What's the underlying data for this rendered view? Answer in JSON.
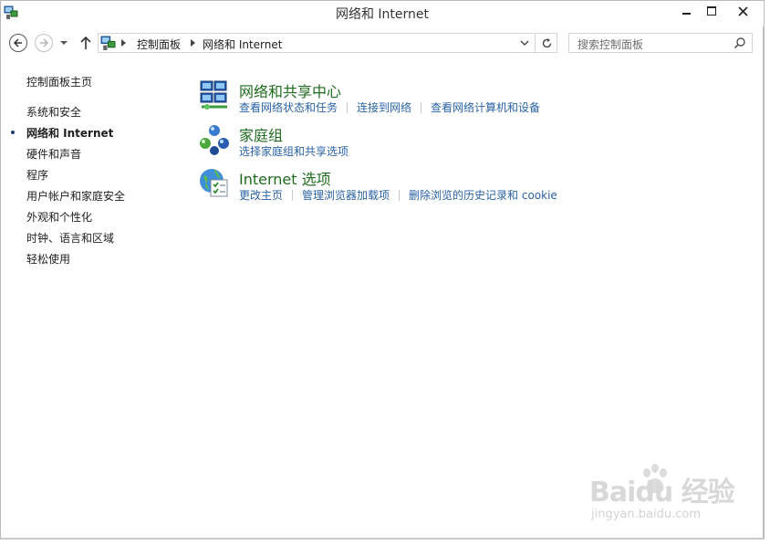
{
  "window": {
    "title": "网络和 Internet"
  },
  "nav": {
    "breadcrumbs": [
      "控制面板",
      "网络和 Internet"
    ],
    "search_placeholder": "搜索控制面板"
  },
  "sidebar": {
    "items": [
      {
        "label": "控制面板主页",
        "active": false
      },
      {
        "label": "系统和安全",
        "active": false
      },
      {
        "label": "网络和 Internet",
        "active": true
      },
      {
        "label": "硬件和声音",
        "active": false
      },
      {
        "label": "程序",
        "active": false
      },
      {
        "label": "用户帐户和家庭安全",
        "active": false
      },
      {
        "label": "外观和个性化",
        "active": false
      },
      {
        "label": "时钟、语言和区域",
        "active": false
      },
      {
        "label": "轻松使用",
        "active": false
      }
    ]
  },
  "categories": [
    {
      "title": "网络和共享中心",
      "icon": "network-sharing-icon",
      "links": [
        "查看网络状态和任务",
        "连接到网络",
        "查看网络计算机和设备"
      ]
    },
    {
      "title": "家庭组",
      "icon": "homegroup-icon",
      "links": [
        "选择家庭组和共享选项"
      ]
    },
    {
      "title": "Internet 选项",
      "icon": "internet-options-icon",
      "links": [
        "更改主页",
        "管理浏览器加载项",
        "删除浏览的历史记录和 cookie"
      ]
    }
  ],
  "watermark": {
    "brand": "Baidu 经验",
    "url": "jingyan.baidu.com"
  },
  "colors": {
    "link": "#2a62a5",
    "category_title": "#1e6b1e",
    "text": "#1e1e1e"
  }
}
